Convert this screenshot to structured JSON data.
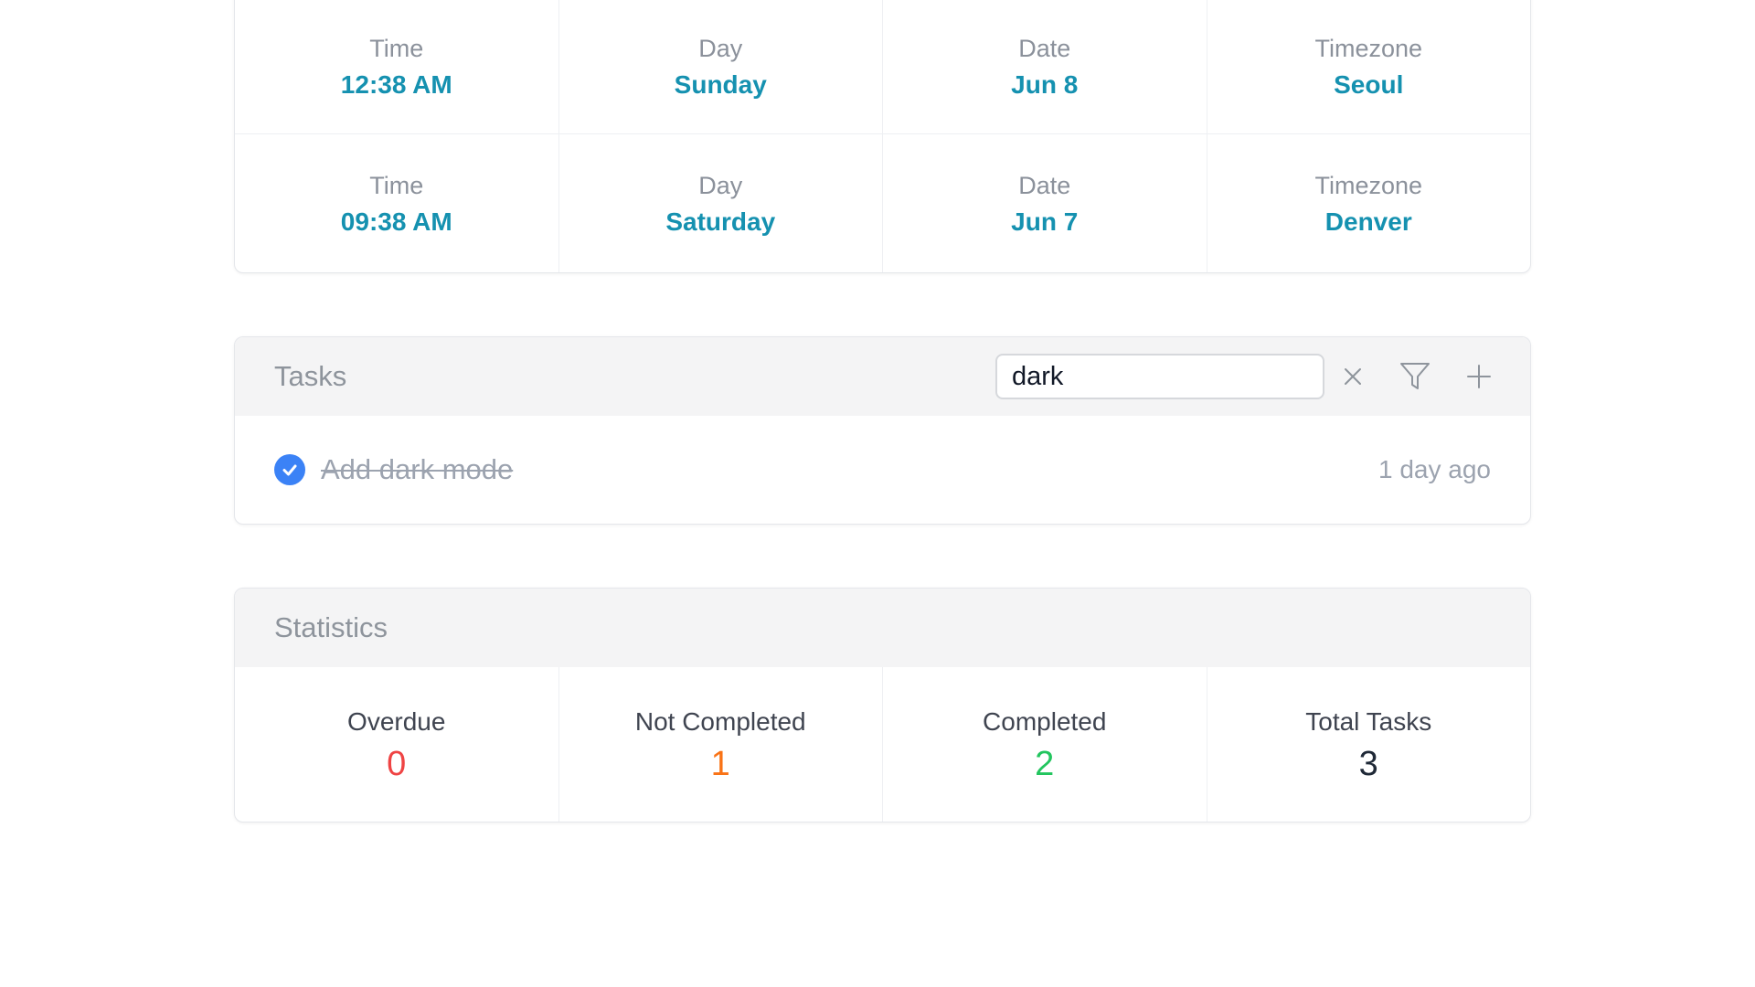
{
  "world_clock": {
    "rows": [
      {
        "time_label": "Time",
        "time": "12:38 AM",
        "day_label": "Day",
        "day": "Sunday",
        "date_label": "Date",
        "date": "Jun 8",
        "tz_label": "Timezone",
        "tz": "Seoul"
      },
      {
        "time_label": "Time",
        "time": "09:38 AM",
        "day_label": "Day",
        "day": "Saturday",
        "date_label": "Date",
        "date": "Jun 7",
        "tz_label": "Timezone",
        "tz": "Denver"
      }
    ],
    "value_color": "#1591b0"
  },
  "tasks": {
    "title": "Tasks",
    "search": {
      "value": "dark",
      "placeholder": ""
    },
    "icons": [
      "close-icon",
      "filter-icon",
      "plus-icon"
    ],
    "items": [
      {
        "label": "Add dark mode",
        "completed": true,
        "time_ago": "1 day ago"
      }
    ],
    "check_color": "#3b82f6"
  },
  "statistics": {
    "title": "Statistics",
    "items": [
      {
        "label": "Overdue",
        "value": "0",
        "color": "#ef4444"
      },
      {
        "label": "Not Completed",
        "value": "1",
        "color": "#f97316"
      },
      {
        "label": "Completed",
        "value": "2",
        "color": "#22c55e"
      },
      {
        "label": "Total Tasks",
        "value": "3",
        "color": "#1f2937"
      }
    ]
  }
}
